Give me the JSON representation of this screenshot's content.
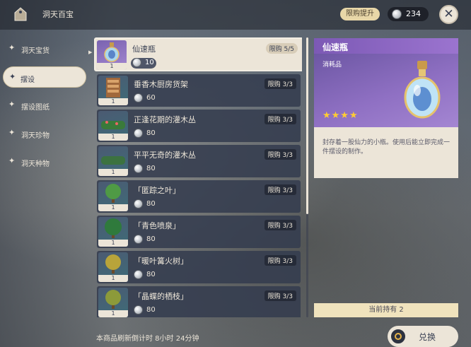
{
  "header": {
    "title": "洞天百宝",
    "bag_icon": "bag-icon",
    "limit_button": "限购提升",
    "currency_icon": "realm-currency-icon",
    "currency_value": "234",
    "close_icon": "close-icon"
  },
  "sidebar": {
    "items": [
      {
        "label": "洞天宝货",
        "active": false
      },
      {
        "label": "摆设",
        "active": true
      },
      {
        "label": "摆设图纸",
        "active": false
      },
      {
        "label": "洞天珍物",
        "active": false
      },
      {
        "label": "洞天种物",
        "active": false
      }
    ]
  },
  "shop": {
    "items": [
      {
        "name": "仙速瓶",
        "limit": "限购 5/5",
        "price": "10",
        "qty": "1",
        "icon": "bottle-icon",
        "selected": true
      },
      {
        "name": "垂香木厨房货架",
        "limit": "限购 3/3",
        "price": "60",
        "qty": "1",
        "icon": "shelf-icon",
        "selected": false
      },
      {
        "name": "正逢花期的灌木丛",
        "limit": "限购 3/3",
        "price": "80",
        "qty": "1",
        "icon": "shrub-icon",
        "selected": false
      },
      {
        "name": "平平无奇的灌木丛",
        "limit": "限购 3/3",
        "price": "80",
        "qty": "1",
        "icon": "shrub-icon",
        "selected": false
      },
      {
        "name": "「匿踪之叶」",
        "limit": "限购 3/3",
        "price": "80",
        "qty": "1",
        "icon": "tree-icon",
        "selected": false
      },
      {
        "name": "「青色喷泉」",
        "limit": "限购 3/3",
        "price": "80",
        "qty": "1",
        "icon": "tree-icon",
        "selected": false
      },
      {
        "name": "「暖叶篝火树」",
        "limit": "限购 3/3",
        "price": "80",
        "qty": "1",
        "icon": "tree-icon",
        "selected": false
      },
      {
        "name": "「晶蝶的栖枝」",
        "limit": "限购 3/3",
        "price": "80",
        "qty": "1",
        "icon": "tree-icon",
        "selected": false
      }
    ]
  },
  "detail": {
    "title": "仙速瓶",
    "type": "消耗品",
    "stars": "★★★★",
    "description": "封存着一股仙力的小瓶。使用后能立即完成一件摆设的制作。",
    "owned": "当前持有 2"
  },
  "footer": {
    "refresh_text": "本商品刷新倒计时 8小时 24分钟",
    "exchange_label": "兑换"
  },
  "colors": {
    "accent_cream": "#ece5d8",
    "panel_dark": "#343c4e",
    "purple": "#7c59b5",
    "star_gold": "#ffcc33"
  }
}
